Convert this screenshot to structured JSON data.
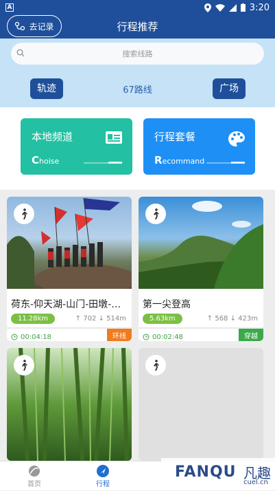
{
  "status_bar": {
    "time": "3:20"
  },
  "header": {
    "record_label": "去记录",
    "title": "行程推荐"
  },
  "search": {
    "placeholder": "搜索线路"
  },
  "tabs": {
    "track_label": "轨迹",
    "route_count": "67路线",
    "plaza_label": "广场"
  },
  "channels": [
    {
      "title": "本地频道",
      "sub_first": "C",
      "sub_rest": "hoise",
      "color": "#24c0a3"
    },
    {
      "title": "行程套餐",
      "sub_first": "R",
      "sub_rest": "ecommand",
      "color": "#1e90f5"
    }
  ],
  "routes": [
    {
      "name": "荷东-仰天湖-山门-田墩-丁家...",
      "distance": "11.28km",
      "ascent": "702",
      "descent": "514m",
      "duration": "00:04:18",
      "type": "环线",
      "type_color": "#f07c1f"
    },
    {
      "name": "第一尖登高",
      "distance": "5.63km",
      "ascent": "568",
      "descent": "423m",
      "duration": "00:02:48",
      "type": "穿越",
      "type_color": "#3aa94a"
    },
    {
      "name": "",
      "distance": "",
      "ascent": "",
      "descent": "",
      "duration": "",
      "type": "",
      "type_color": ""
    },
    {
      "name": "",
      "distance": "",
      "ascent": "",
      "descent": "",
      "duration": "",
      "type": "",
      "type_color": ""
    }
  ],
  "bottom_nav": {
    "home_label": "首页",
    "trip_label": "行程"
  },
  "watermark": {
    "brand": "FANQU",
    "cn": "凡趣",
    "url": "cuel.cn"
  }
}
